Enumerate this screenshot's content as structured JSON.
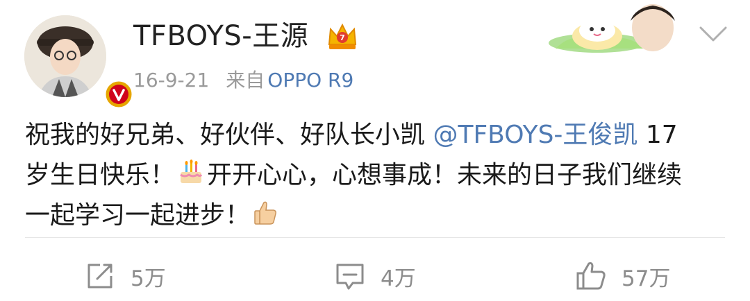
{
  "post": {
    "username": "TFBOYS-王源",
    "date": "16-9-21",
    "source_label": "来自",
    "device": "OPPO R9",
    "content": {
      "line1_text": "祝我的好兄弟、好伙伴、好队长小凯 ",
      "mention": "@TFBOYS-王俊凯",
      "line1_tail": " 17",
      "line2_text": "岁生日快乐！",
      "line2_after_emoji": "开开心心，心想事成！未来的日子我们继续",
      "line3_text": "一起学习一起进步！"
    },
    "emojis": [
      "birthday-cake-emoji",
      "thumbs-up-emoji"
    ]
  },
  "actions": {
    "repost_count": "5万",
    "comment_count": "4万",
    "like_count": "57万"
  },
  "colors": {
    "link": "#4f7ab3",
    "meta": "#9a9a9a",
    "text": "#1a1a1a",
    "icon": "#8c8c8c",
    "verified": "#e6a600"
  }
}
